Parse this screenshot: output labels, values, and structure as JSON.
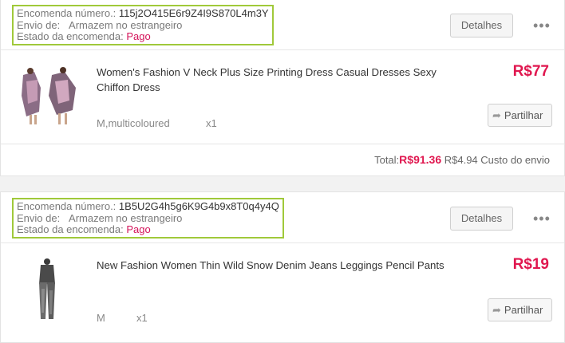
{
  "orders": [
    {
      "number_label": "Encomenda número.:",
      "number": "115j2O415E6r9Z4I9S870L4m3Y",
      "shipping_label": "Envio de:",
      "shipping": "Armazem no estrangeiro",
      "status_label": "Estado da encomenda:",
      "status": "Pago",
      "details_label": "Detalhes",
      "more_label": "•••",
      "item": {
        "title": "Women's Fashion V Neck Plus Size Printing Dress Casual Dresses Sexy Chiffon Dress",
        "variant": "M,multicoloured",
        "qty": "x1",
        "price": "R$77",
        "share_label": "Partilhar"
      },
      "total_label": "Total:",
      "total_amount": "R$91.36",
      "shipping_cost": "R$4.94 Custo do envio"
    },
    {
      "number_label": "Encomenda número.:",
      "number": "1B5U2G4h5g6K9G4b9x8T0q4y4Q",
      "shipping_label": "Envio de:",
      "shipping": "Armazem no estrangeiro",
      "status_label": "Estado da encomenda:",
      "status": "Pago",
      "details_label": "Detalhes",
      "more_label": "•••",
      "item": {
        "title": "New Fashion Women Thin Wild Snow Denim Jeans Leggings Pencil Pants",
        "variant": "M",
        "qty": "x1",
        "price": "R$19",
        "share_label": "Partilhar"
      }
    }
  ],
  "icons": {
    "share": "share-arrow-icon",
    "more": "more-dots-icon"
  },
  "colors": {
    "price": "#e0174f",
    "status": "#d4145a",
    "highlight": "#a0c93a"
  }
}
